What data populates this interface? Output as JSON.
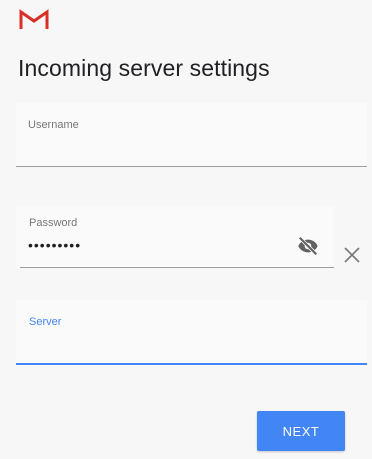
{
  "header": {
    "logo_icon": "gmail-m-icon",
    "title": "Incoming server settings"
  },
  "form": {
    "username": {
      "label": "Username",
      "value": ""
    },
    "password": {
      "label": "Password",
      "value": "•••••••••",
      "visibility_icon": "eye-off-icon"
    },
    "clear_icon": "close-icon",
    "server": {
      "label": "Server",
      "value": ""
    }
  },
  "actions": {
    "next_label": "NEXT"
  },
  "colors": {
    "accent": "#4285f4",
    "gmail_red": "#d93025",
    "title_text": "#202124",
    "hint_text": "#777777"
  }
}
